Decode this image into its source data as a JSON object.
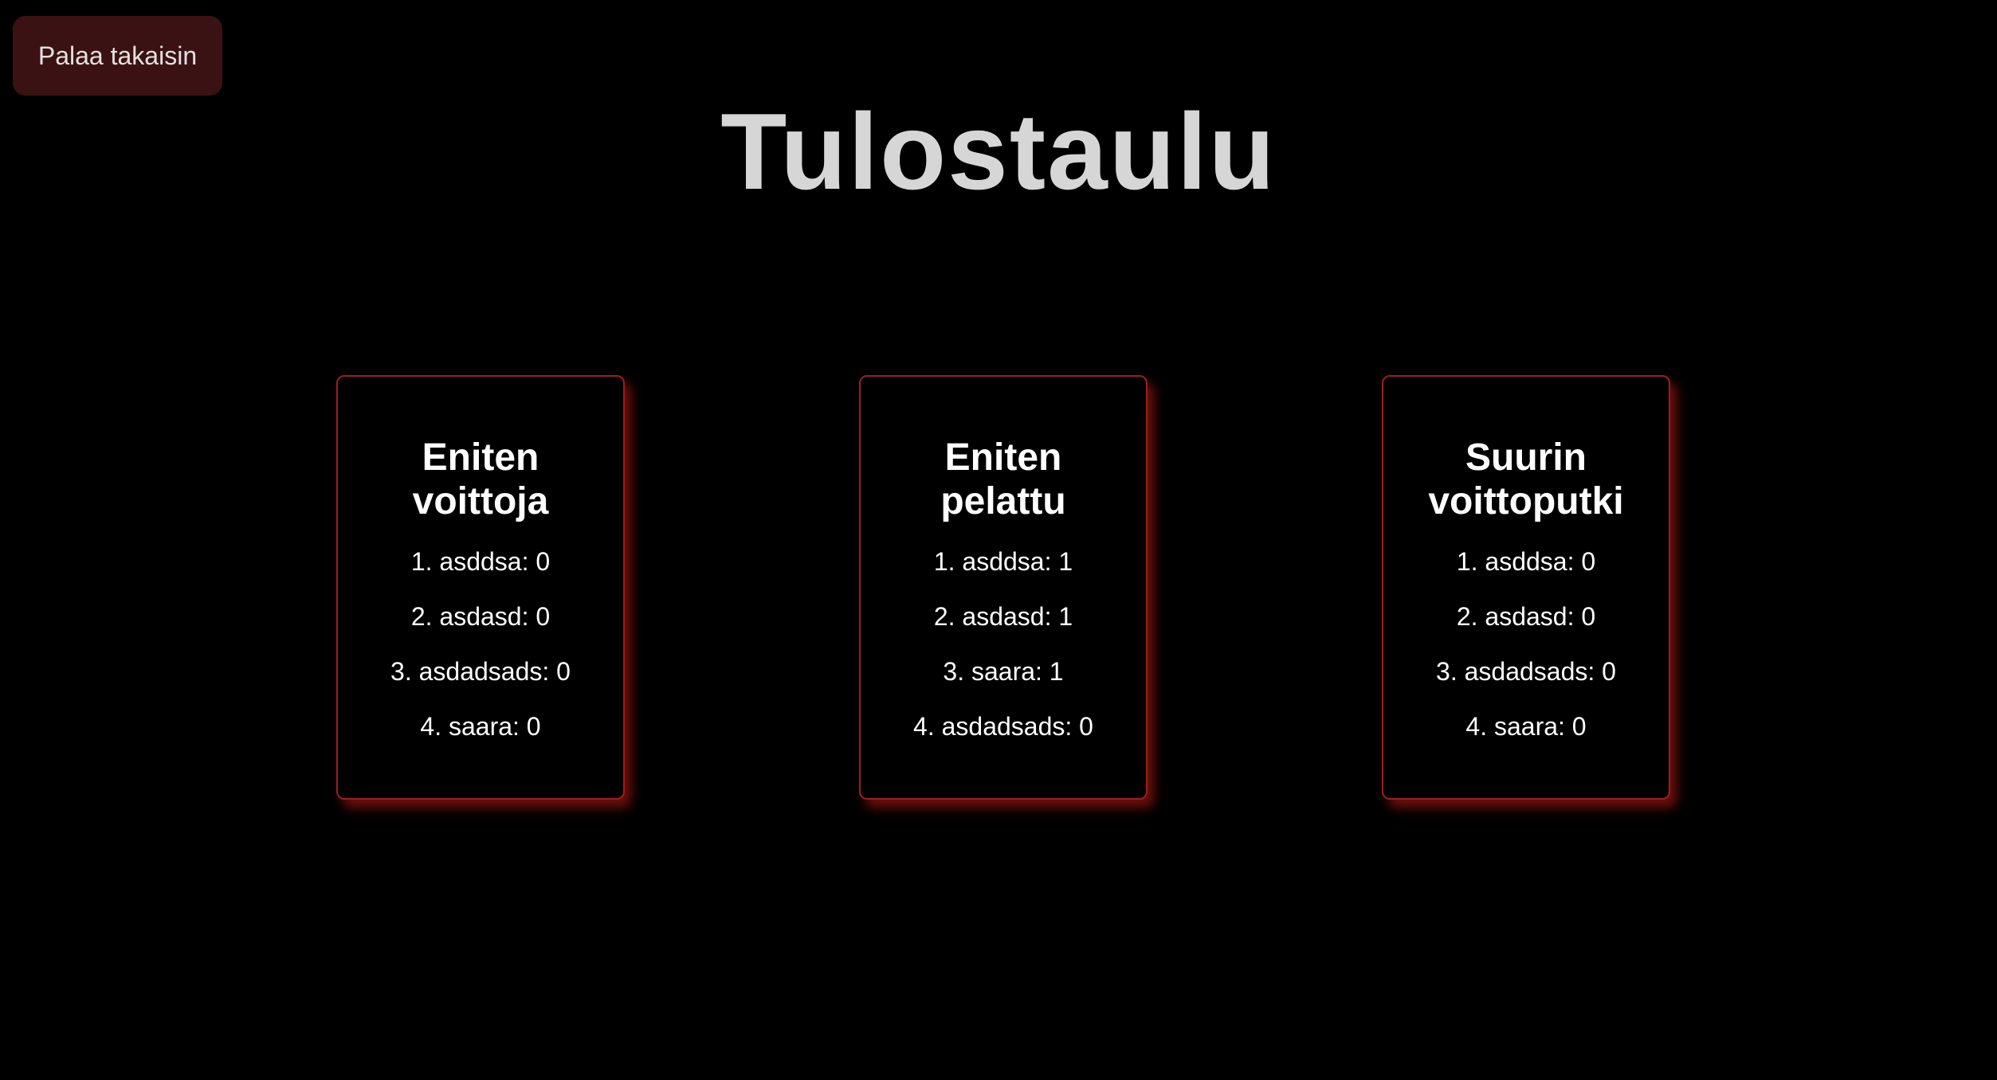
{
  "back_button": {
    "label": "Palaa takaisin"
  },
  "title": "Tulostaulu",
  "colors": {
    "background": "#000000",
    "accent_border": "#9b1f1f",
    "button_background": "#3a1213",
    "title_text": "#d6d6d6"
  },
  "cards": [
    {
      "title_line1": "Eniten",
      "title_line2": "voittoja",
      "entries": [
        "1. asddsa: 0",
        "2. asdasd: 0",
        "3. asdadsads: 0",
        "4. saara: 0"
      ]
    },
    {
      "title_line1": "Eniten",
      "title_line2": "pelattu",
      "entries": [
        "1. asddsa: 1",
        "2. asdasd: 1",
        "3. saara: 1",
        "4. asdadsads: 0"
      ]
    },
    {
      "title_line1": "Suurin",
      "title_line2": "voittoputki",
      "entries": [
        "1. asddsa: 0",
        "2. asdasd: 0",
        "3. asdadsads: 0",
        "4. saara: 0"
      ]
    }
  ]
}
